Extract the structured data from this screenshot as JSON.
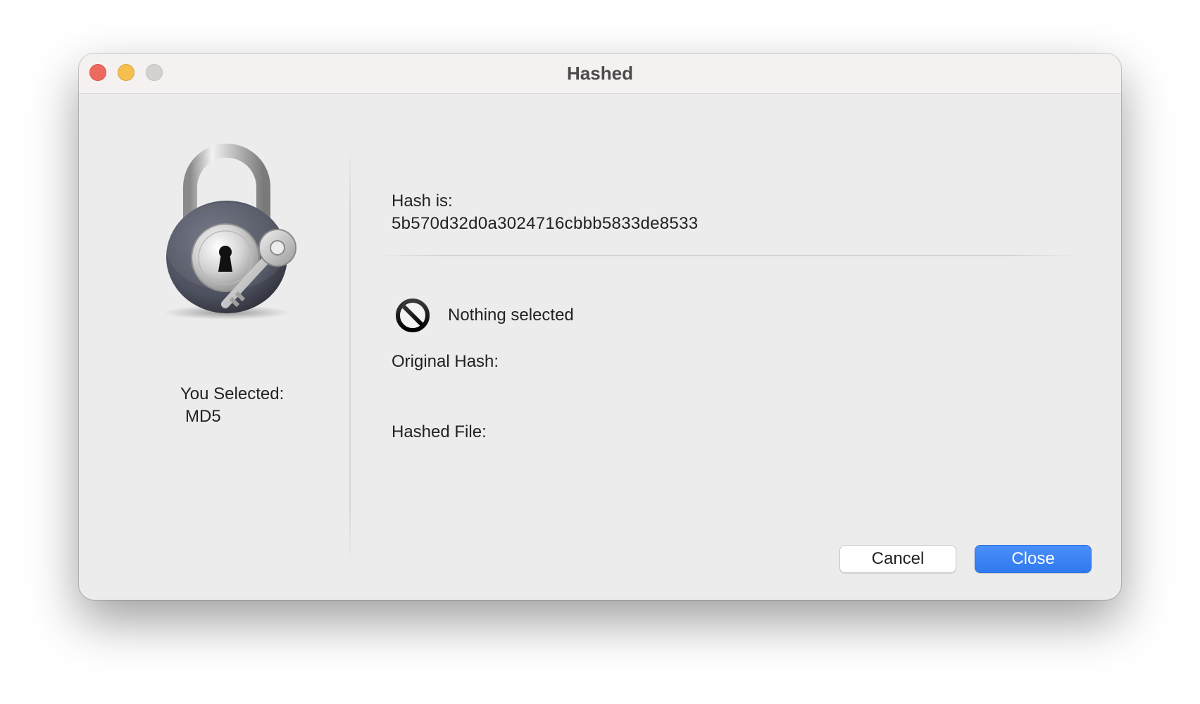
{
  "window": {
    "title": "Hashed"
  },
  "left_panel": {
    "selected_label": "You Selected:",
    "selected_value": "MD5",
    "icon": "padlock-with-key-icon"
  },
  "right_panel": {
    "hash_label": "Hash is:",
    "hash_value": "5b570d32d0a3024716cbbb5833de8533",
    "status_icon": "prohibited-icon",
    "status_text": "Nothing selected",
    "original_hash_label": "Original Hash:",
    "hashed_file_label": "Hashed File:"
  },
  "buttons": {
    "cancel_label": "Cancel",
    "close_label": "Close"
  },
  "colors": {
    "accent": "#2f7af0",
    "traffic_close": "#ed6a5e",
    "traffic_minimize": "#f5bf4f",
    "traffic_zoom_disabled": "#d4d2d1"
  }
}
